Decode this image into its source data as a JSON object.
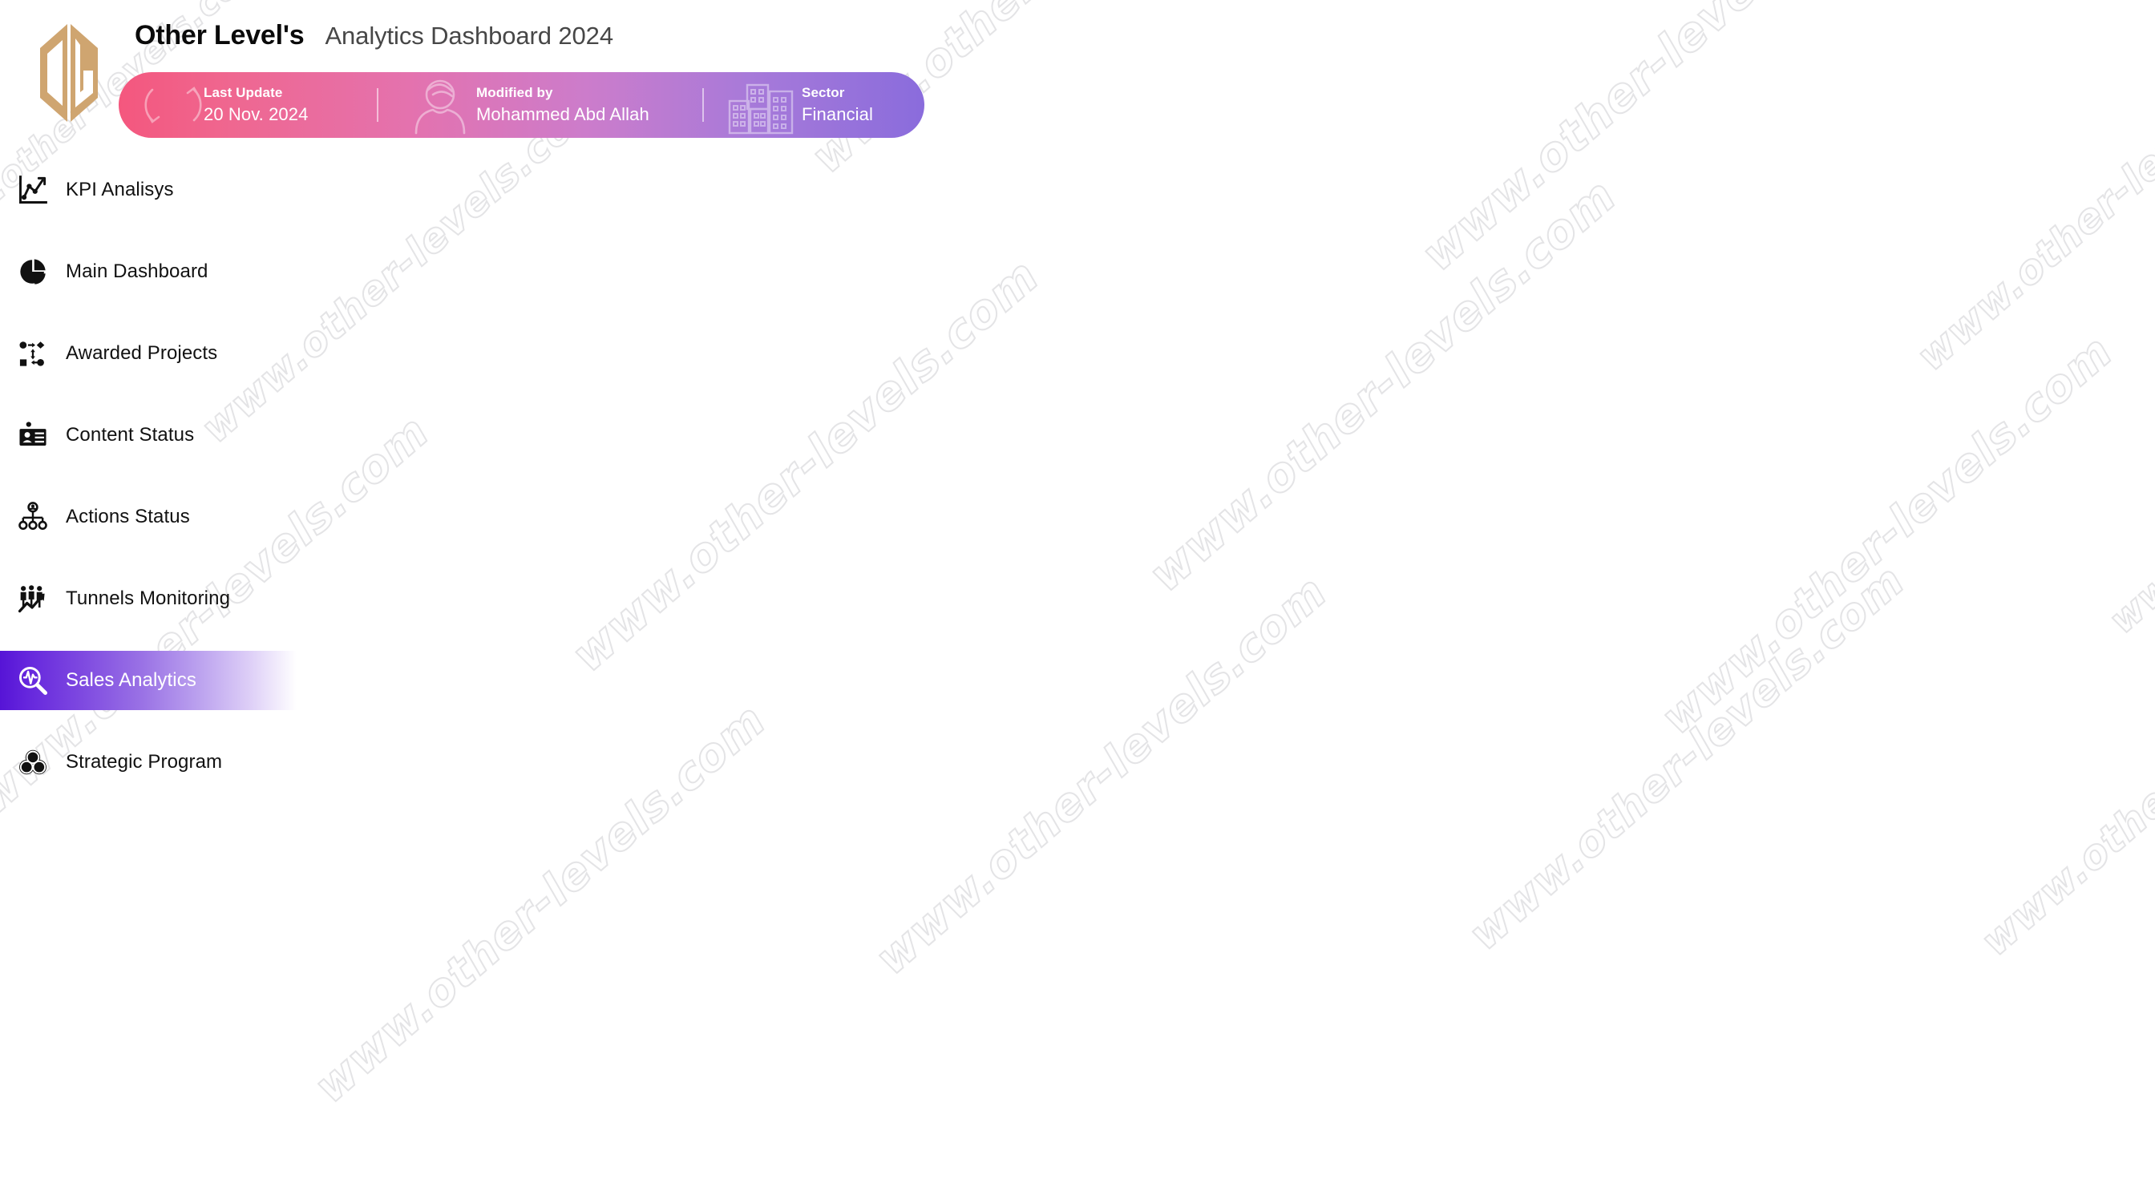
{
  "header": {
    "logo_icon": "ol-monogram-logo",
    "brand_name": "Other Level's",
    "subtitle": "Analytics Dashboard 2024"
  },
  "info_bar": {
    "segments": [
      {
        "label": "Last Update",
        "value": "20 Nov. 2024",
        "icon": "refresh-arrows-icon"
      },
      {
        "label": "Modified by",
        "value": "Mohammed Abd Allah",
        "icon": "user-person-icon"
      },
      {
        "label": "Sector",
        "value": "Financial",
        "icon": "buildings-city-icon"
      }
    ],
    "gradient_start": "#f4577e",
    "gradient_end": "#8a6cdc"
  },
  "sidebar": {
    "active_index": 6,
    "active_gradient_start": "#5614d6",
    "items": [
      {
        "label": "KPI Analisys",
        "icon": "line-chart-axis-icon"
      },
      {
        "label": "Main Dashboard",
        "icon": "pie-chart-icon"
      },
      {
        "label": "Awarded Projects",
        "icon": "workflow-nodes-icon"
      },
      {
        "label": "Content Status",
        "icon": "id-card-icon"
      },
      {
        "label": "Actions Status",
        "icon": "org-hierarchy-icon"
      },
      {
        "label": "Tunnels Monitoring",
        "icon": "people-trend-arrow-icon"
      },
      {
        "label": "Sales Analytics",
        "icon": "magnifier-pulse-icon"
      },
      {
        "label": "Strategic Program",
        "icon": "venn-three-circles-icon"
      }
    ]
  },
  "watermark": {
    "text": "www.other-levels.com",
    "color": "#e4e4e6"
  }
}
